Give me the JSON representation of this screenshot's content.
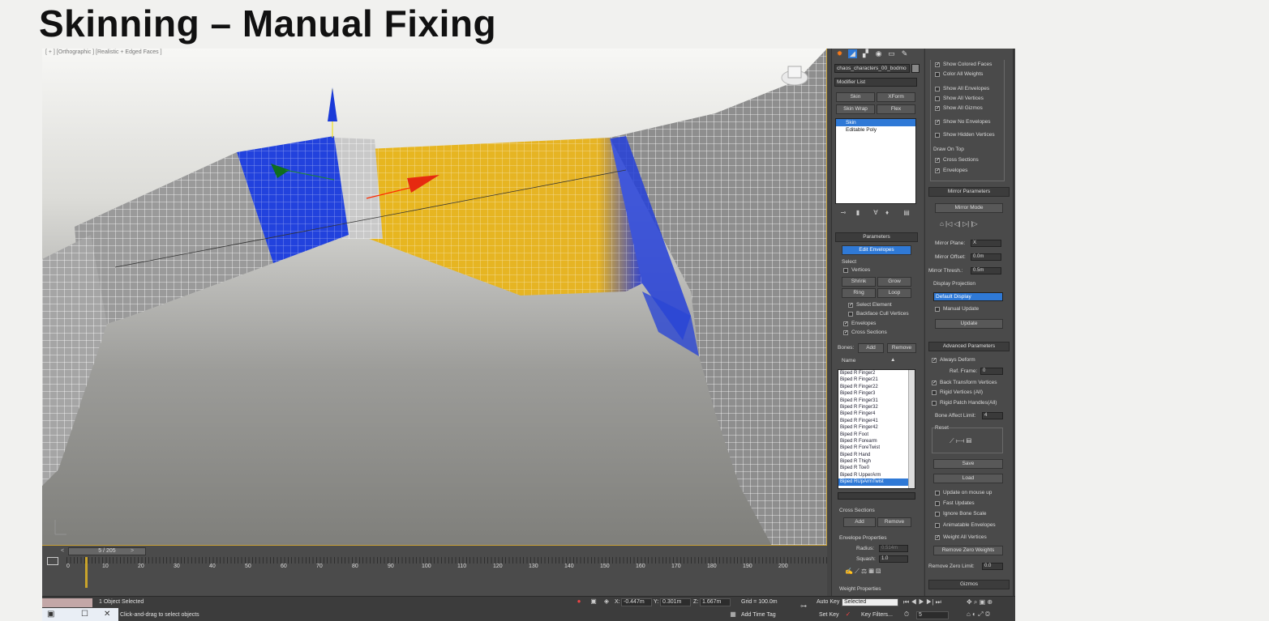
{
  "slide_title": "Skinning – Manual Fixing",
  "viewport": {
    "label": "[ + ] [Orthographic ] [Realistic + Edged Faces ]"
  },
  "timeline": {
    "frame_display": "5 / 205",
    "ticks": [
      "0",
      "10",
      "20",
      "30",
      "40",
      "50",
      "60",
      "70",
      "80",
      "90",
      "100",
      "110",
      "120",
      "130",
      "140",
      "150",
      "160",
      "170",
      "180",
      "190",
      "200"
    ]
  },
  "status": {
    "selected": "1 Object Selected",
    "prompt": "Click-and-drag to select objects",
    "x_label": "X:",
    "x_value": "-0.447m",
    "y_label": "Y:",
    "y_value": "0.301m",
    "z_label": "Z:",
    "z_value": "1.667m",
    "grid": "Grid = 100.0m",
    "add_time_tag": "Add Time Tag",
    "auto_key": "Auto Key",
    "auto_key_value": "Selected",
    "set_key": "Set Key",
    "key_filters": "Key Filters...",
    "frame_field": "5"
  },
  "panel": {
    "object_name": "chaos_characters_00_bodmo",
    "modifier_list": "Modifier List",
    "mod_buttons": [
      "Skin",
      "XForm",
      "Skin Wrap",
      "Flex"
    ],
    "stack": [
      {
        "label": "Skin",
        "selected": true
      },
      {
        "label": "Editable Poly",
        "selected": false
      }
    ],
    "parameters_header": "Parameters",
    "edit_envelopes": "Edit Envelopes",
    "select_label": "Select",
    "vertices": "Vertices",
    "shrink": "Shrink",
    "grow": "Grow",
    "ring": "Ring",
    "loop": "Loop",
    "select_element": "Select Element",
    "backface_cull": "Backface Cull Vertices",
    "envelopes": "Envelopes",
    "cross_sections": "Cross Sections",
    "bones_label": "Bones:",
    "add": "Add",
    "remove": "Remove",
    "name_label": "Name",
    "bones": [
      "Biped R Finger2",
      "Biped R Finger21",
      "Biped R Finger22",
      "Biped R Finger3",
      "Biped R Finger31",
      "Biped R Finger32",
      "Biped R Finger4",
      "Biped R Finger41",
      "Biped R Finger42",
      "Biped R Foot",
      "Biped R Forearm",
      "Biped R ForeTwist",
      "Biped R Hand",
      "Biped R Thigh",
      "Biped R Toe0",
      "Biped R UpperArm",
      "Biped RUpArmTwist"
    ],
    "selected_bone": "Biped RUpArmTwist",
    "cross_sections_label": "Cross Sections",
    "cs_add": "Add",
    "cs_remove": "Remove",
    "envelope_properties": "Envelope Properties",
    "radius_label": "Radius:",
    "radius_value": "0.514m",
    "squash_label": "Squash:",
    "squash_value": "1.0",
    "weight_properties": "Weight Properties"
  },
  "panel2": {
    "show_colored_faces": "Show Colored Faces",
    "color_all_weights": "Color All Weights",
    "show_all_envelopes": "Show All Envelopes",
    "show_all_vertices": "Show All Vertices",
    "show_all_gizmos": "Show All Gizmos",
    "show_no_envelopes": "Show No Envelopes",
    "show_hidden_vertices": "Show Hidden Vertices",
    "draw_on_top": "Draw On Top",
    "cross_sections": "Cross Sections",
    "envelopes": "Envelopes",
    "mirror_parameters": "Mirror Parameters",
    "mirror_mode": "Mirror Mode",
    "mirror_plane": "Mirror Plane:",
    "mirror_plane_value": "X",
    "mirror_offset": "Mirror Offset:",
    "mirror_offset_value": "0.0m",
    "mirror_thresh": "Mirror Thresh.:",
    "mirror_thresh_value": "0.5m",
    "display_projection": "Display Projection",
    "default_display": "Default Display",
    "manual_update": "Manual Update",
    "update": "Update",
    "advanced_parameters": "Advanced Parameters",
    "always_deform": "Always Deform",
    "ref_frame": "Ref. Frame:",
    "ref_frame_value": "0",
    "back_transform": "Back Transform Vertices",
    "rigid_vertices": "Rigid Vertices (All)",
    "rigid_patch": "Rigid Patch Handles(All)",
    "bone_affect_limit": "Bone Affect Limit:",
    "bone_affect_value": "4",
    "reset": "Reset",
    "save": "Save",
    "load": "Load",
    "update_on_mouse_up": "Update on mouse up",
    "fast_updates": "Fast Updates",
    "ignore_bone_scale": "Ignore Bone Scale",
    "animatable_envelopes": "Animatable Envelopes",
    "weight_all_vertices": "Weight All Vertices",
    "remove_zero_weights": "Remove Zero Weights",
    "remove_zero_limit": "Remove Zero Limit:",
    "remove_zero_value": "0.0",
    "gizmos": "Gizmos"
  },
  "colors": {
    "weight_full": "#e8b820",
    "weight_low": "#1f3de0",
    "selection": "#2f79d6",
    "panel_bg": "#4a4a4a"
  }
}
